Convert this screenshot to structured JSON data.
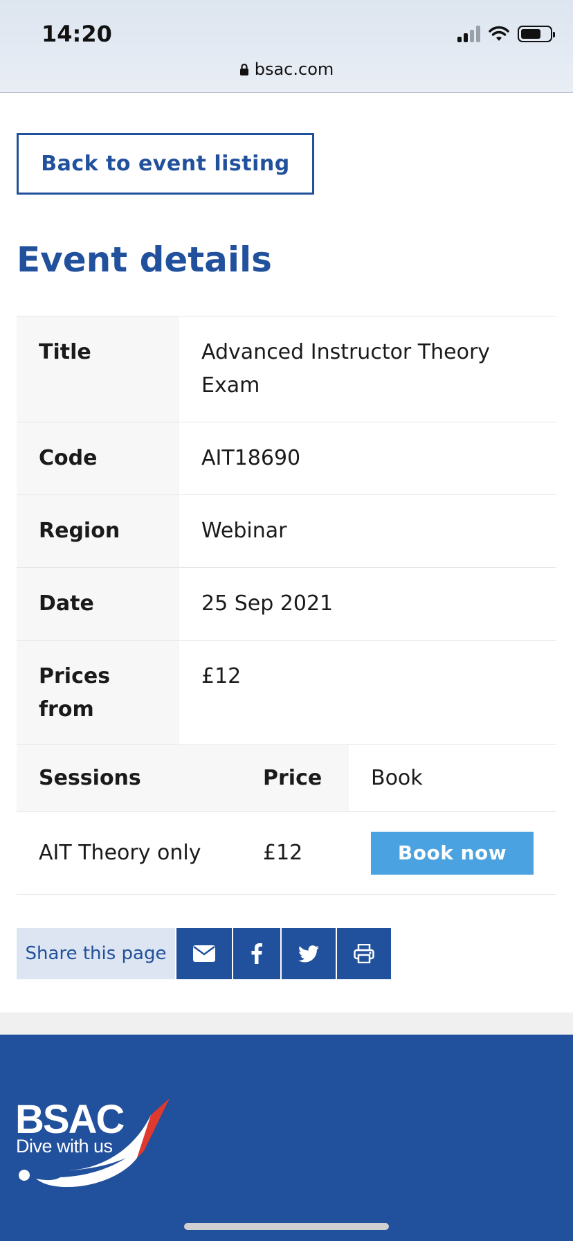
{
  "statusbar": {
    "time": "14:20",
    "url": "bsac.com"
  },
  "back_button": "Back to event listing",
  "page_title": "Event details",
  "details": [
    {
      "label": "Title",
      "value": "Advanced Instructor Theory Exam"
    },
    {
      "label": "Code",
      "value": "AIT18690"
    },
    {
      "label": "Region",
      "value": "Webinar"
    },
    {
      "label": "Date",
      "value": "25 Sep 2021"
    },
    {
      "label": "Prices from",
      "value": "£12"
    }
  ],
  "sessions": {
    "headers": {
      "sessions": "Sessions",
      "price": "Price",
      "book": "Book"
    },
    "rows": [
      {
        "session": "AIT Theory only",
        "price": "£12",
        "button": "Book now"
      }
    ]
  },
  "share": {
    "label": "Share this page",
    "icons": [
      "envelope-icon",
      "facebook-icon",
      "twitter-icon",
      "print-icon"
    ]
  },
  "footer": {
    "logo_text": "BSAC",
    "tagline": "Dive with us"
  },
  "colors": {
    "brand_blue": "#21509c",
    "book_button": "#4aa3e0",
    "share_label_bg": "#dce5f1",
    "logo_swoosh": "#e03a2e"
  }
}
